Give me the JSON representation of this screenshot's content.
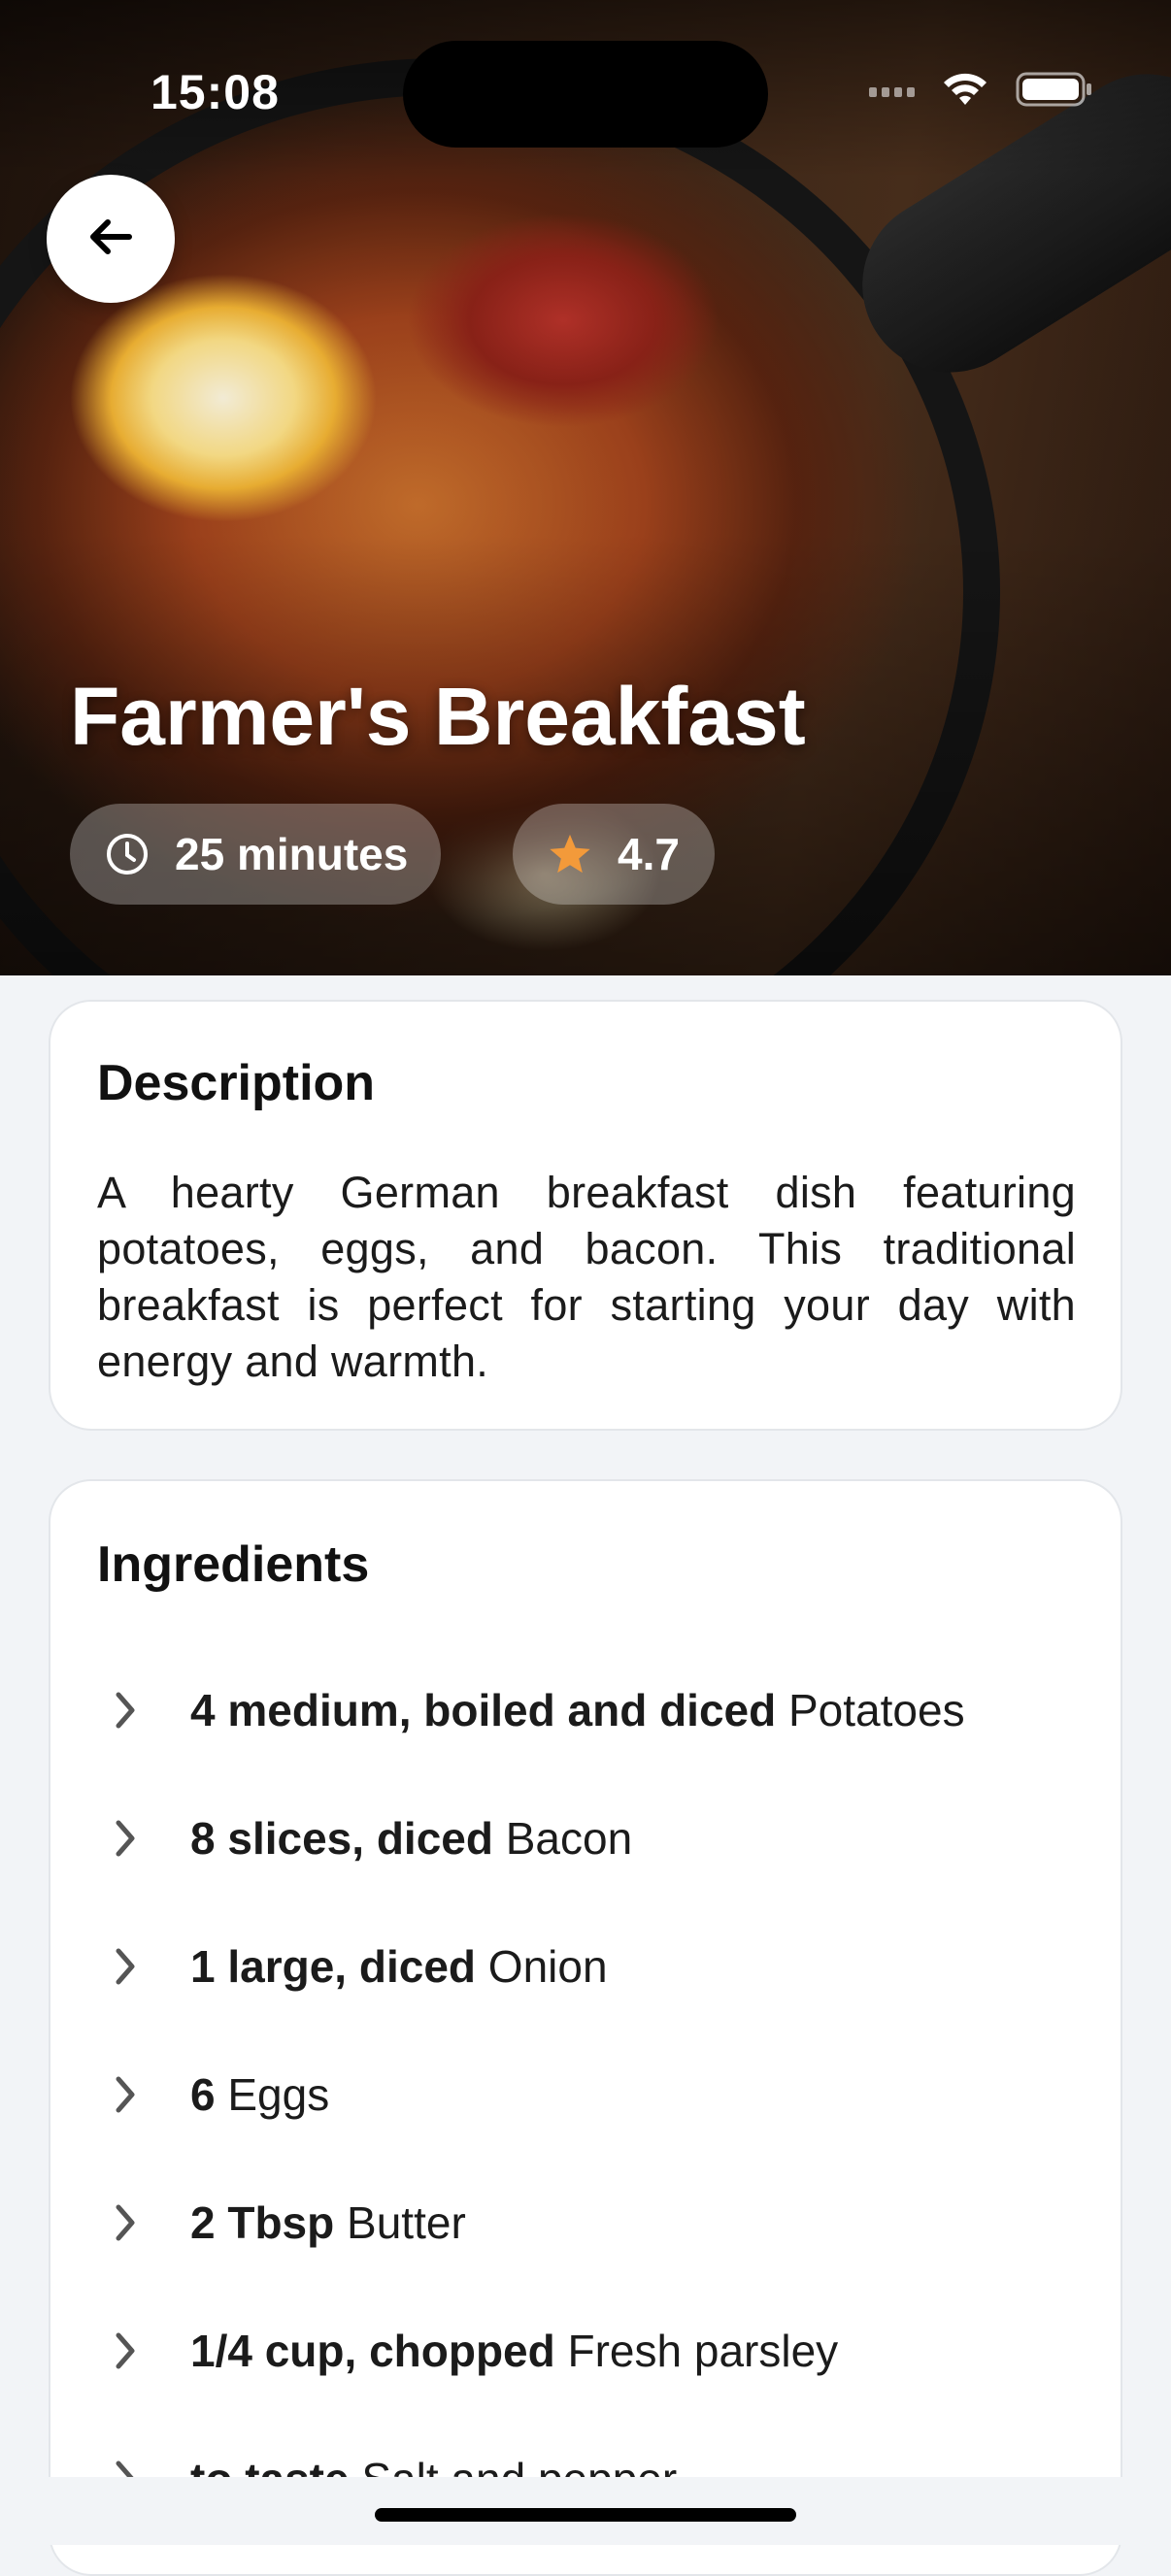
{
  "status_bar": {
    "time": "15:08"
  },
  "hero": {
    "title": "Farmer's Breakfast",
    "time_label": "25 minutes",
    "rating": "4.7",
    "rating_color": "#f39a3a"
  },
  "description": {
    "heading": "Description",
    "text": "A hearty German breakfast dish featuring potatoes, eggs, and bacon. This traditional breakfast is perfect for starting your day with energy and warmth."
  },
  "ingredients": {
    "heading": "Ingredients",
    "items": [
      {
        "amount": "4 medium, boiled and diced",
        "name": "Potatoes"
      },
      {
        "amount": "8 slices, diced",
        "name": "Bacon"
      },
      {
        "amount": "1 large, diced",
        "name": "Onion"
      },
      {
        "amount": "6",
        "name": "Eggs"
      },
      {
        "amount": "2 Tbsp",
        "name": "Butter"
      },
      {
        "amount": "1/4 cup, chopped",
        "name": "Fresh parsley"
      },
      {
        "amount": "to taste",
        "name": "Salt and pepper"
      }
    ]
  },
  "icons": {
    "back": "arrow-left-icon",
    "clock": "clock-icon",
    "star": "star-icon",
    "chevron": "chevron-right-icon",
    "wifi": "wifi-icon",
    "battery": "battery-icon"
  }
}
